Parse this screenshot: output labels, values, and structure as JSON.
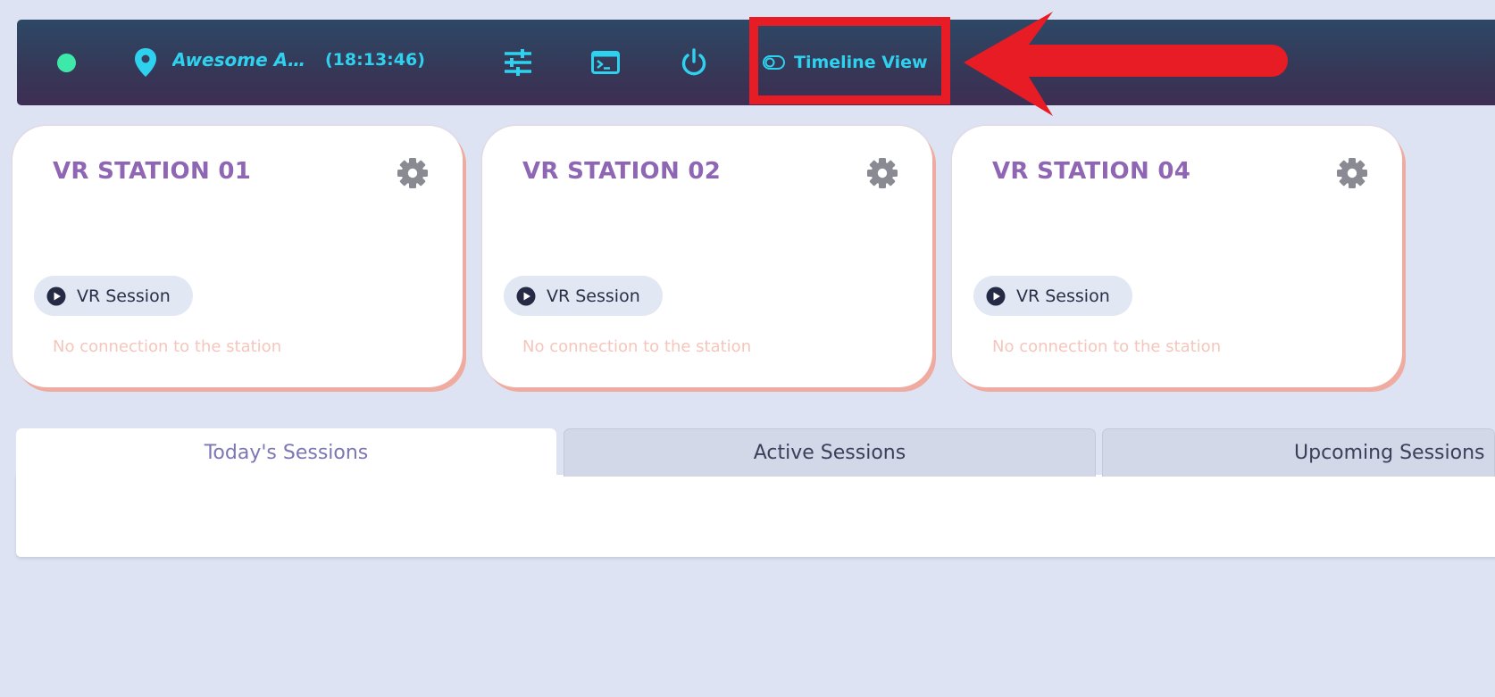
{
  "topbar": {
    "status_color": "#3ee8a9",
    "location_icon": "map-pin-icon",
    "location_name": "Awesome Arc...",
    "clock": "(18:13:46)",
    "tools": [
      {
        "name": "settings-sliders-icon"
      },
      {
        "name": "terminal-icon"
      },
      {
        "name": "power-icon"
      }
    ],
    "timeline_toggle": {
      "icon": "toggle-icon",
      "label": "Timeline View"
    },
    "accent_color": "#2fd2ee"
  },
  "annotation": {
    "highlight_color": "#e81c24"
  },
  "stations": [
    {
      "title": "VR STATION 01",
      "session_label": "VR Session",
      "status": "No connection to the station"
    },
    {
      "title": "VR STATION 02",
      "session_label": "VR Session",
      "status": "No connection to the station"
    },
    {
      "title": "VR STATION 04",
      "session_label": "VR Session",
      "status": "No connection to the station"
    }
  ],
  "tabs": [
    {
      "label": "Today's Sessions",
      "active": true
    },
    {
      "label": "Active Sessions",
      "active": false
    },
    {
      "label": "Upcoming Sessions",
      "active": false
    }
  ]
}
